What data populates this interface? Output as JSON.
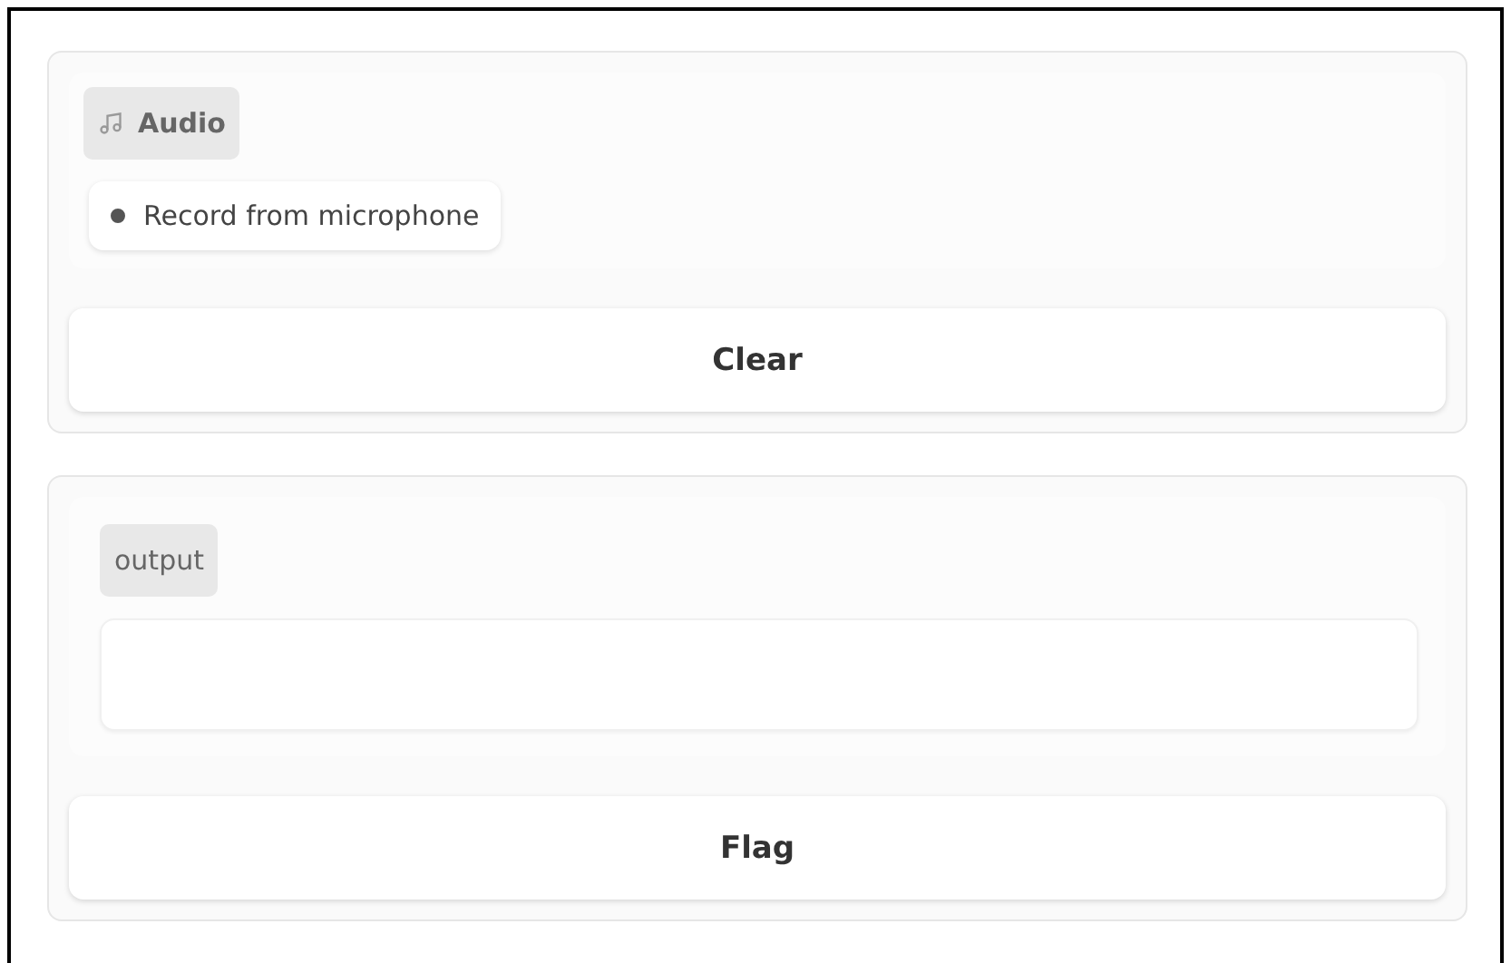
{
  "input_panel": {
    "label": "Audio",
    "sources": [
      {
        "label": "Record from microphone",
        "selected": true
      }
    ],
    "button": "Clear"
  },
  "output_panel": {
    "label": "output",
    "button": "Flag"
  }
}
